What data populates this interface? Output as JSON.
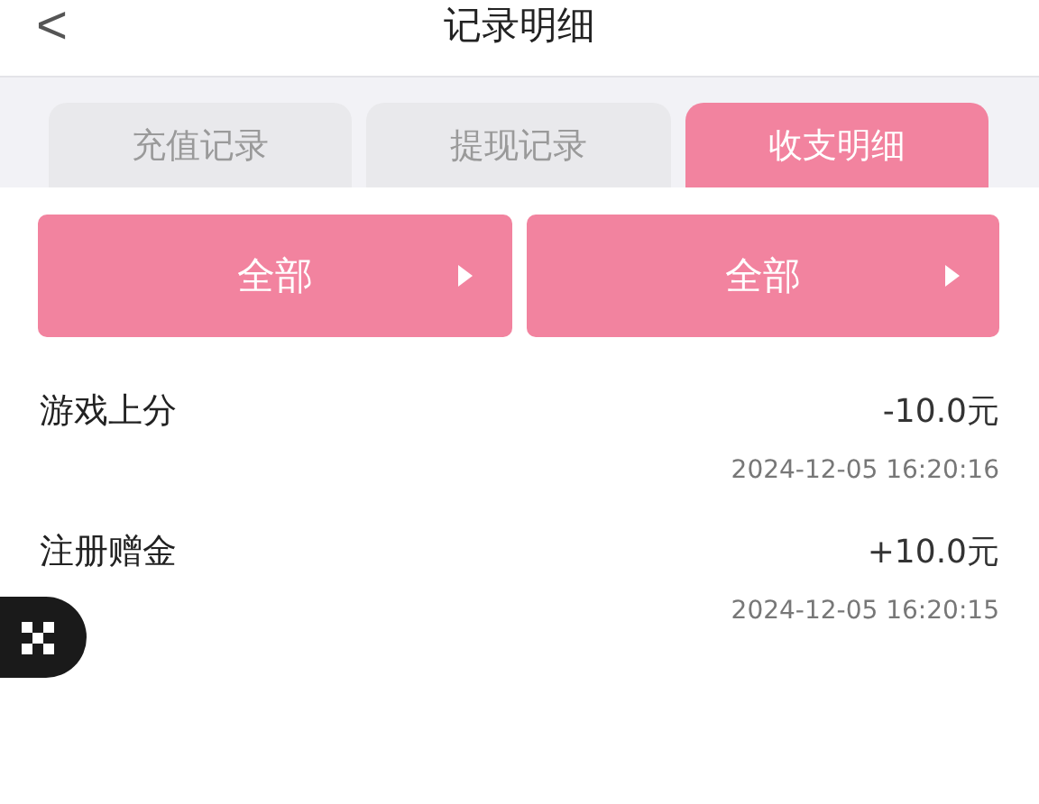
{
  "header": {
    "back_icon": "<",
    "title": "记录明细"
  },
  "tabs": [
    {
      "label": "充值记录",
      "selected": false
    },
    {
      "label": "提现记录",
      "selected": false
    },
    {
      "label": "收支明细",
      "selected": true
    }
  ],
  "filters": [
    {
      "label": "全部"
    },
    {
      "label": "全部"
    }
  ],
  "records": [
    {
      "title": "游戏上分",
      "amount": "-10.0元",
      "time": "2024-12-05 16:20:16"
    },
    {
      "title": "注册赠金",
      "amount": "+10.0元",
      "time": "2024-12-05 16:20:15"
    }
  ]
}
